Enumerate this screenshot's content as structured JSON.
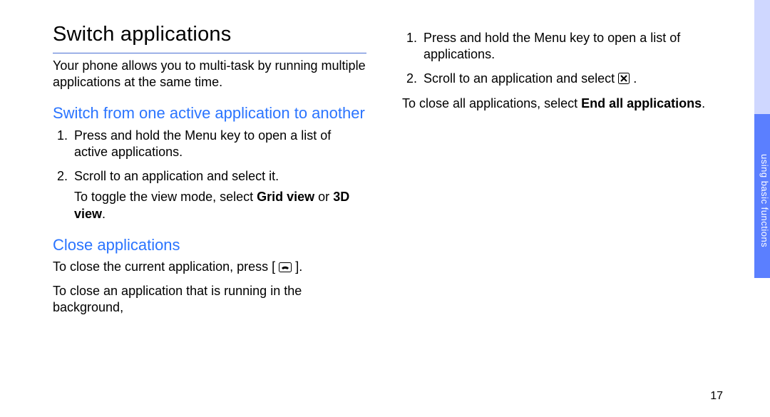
{
  "page_number": "17",
  "side_tab": "using basic functions",
  "left": {
    "title": "Switch applications",
    "intro": "Your phone allows you to multi-task by running multiple applications at the same time.",
    "sub1_title": "Switch from one active application to another",
    "sub1_steps": {
      "s1": "Press and hold the Menu key to open a list of active applications.",
      "s2_main": "Scroll to an application and select it.",
      "s2_sub_a": "To toggle the view mode, select ",
      "s2_sub_grid": "Grid view",
      "s2_sub_b": " or ",
      "s2_sub_3d": "3D view",
      "s2_sub_c": "."
    },
    "sub2_title": "Close applications",
    "sub2_p1_a": "To close the current application, press [",
    "sub2_p1_b": "].",
    "sub2_p2": "To close an application that is running in the background,"
  },
  "right": {
    "steps": {
      "s1": "Press and hold the Menu key to open a list of applications.",
      "s2_a": "Scroll to an application and select ",
      "s2_b": " ."
    },
    "closing_a": "To close all applications, select ",
    "closing_bold": "End all applications",
    "closing_b": "."
  }
}
